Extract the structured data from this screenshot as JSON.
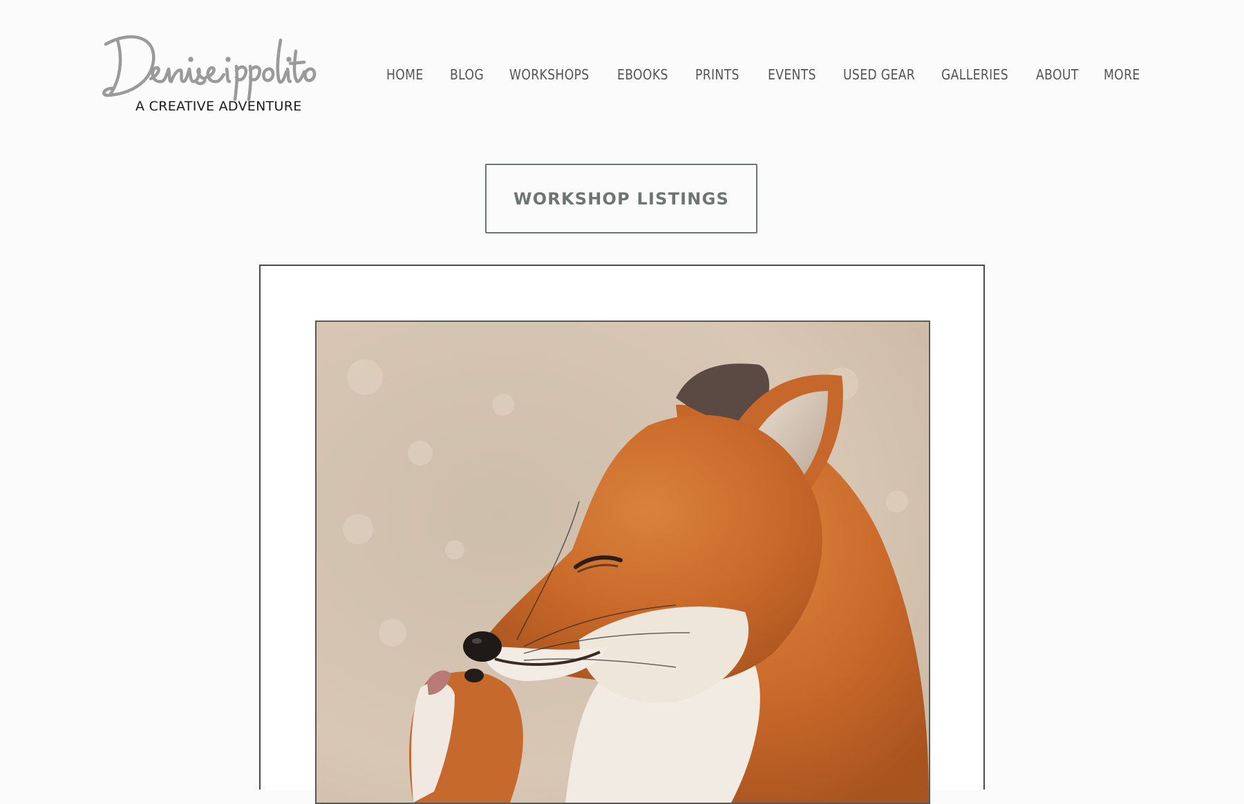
{
  "logo": {
    "script_text": "Denise ippolito",
    "tagline": "A CREATIVE ADVENTURE"
  },
  "nav": {
    "items": [
      "HOME",
      "BLOG",
      "WORKSHOPS",
      "EBOOKS",
      "PRINTS",
      "EVENTS",
      "USED GEAR",
      "GALLERIES",
      "ABOUT",
      "MORE"
    ]
  },
  "cta": {
    "label": "WORKSHOP LISTINGS"
  },
  "colors": {
    "page_background": "#fbfbfb",
    "nav_text": "#555555",
    "button_text": "#6d7474",
    "frame_background": "#ffffff"
  }
}
